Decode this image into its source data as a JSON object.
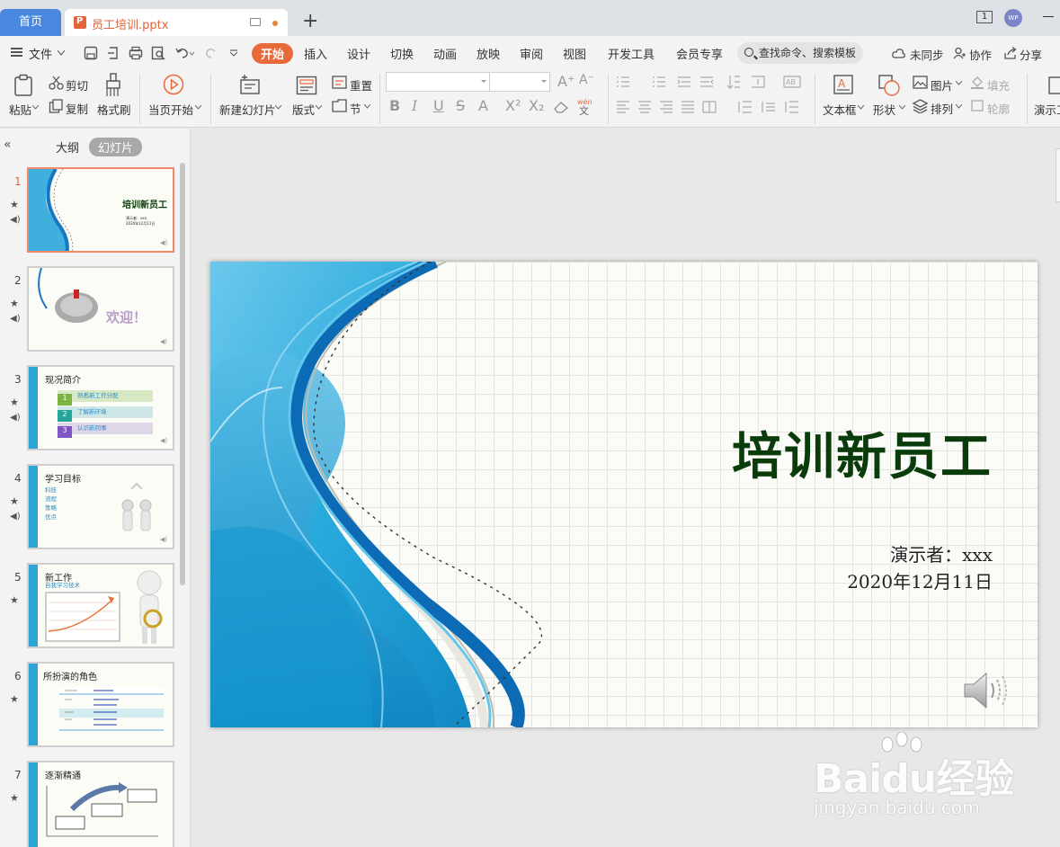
{
  "tabs": {
    "home": "首页",
    "doc": "员工培训.pptx",
    "add": "+"
  },
  "window": {
    "num": "1",
    "avatar": "WP"
  },
  "menu": {
    "file": "文件",
    "tabs": [
      "开始",
      "插入",
      "设计",
      "切换",
      "动画",
      "放映",
      "审阅",
      "视图",
      "开发工具",
      "会员专享"
    ],
    "search": "查找命令、搜索模板",
    "unsynced": "未同步",
    "collab": "协作",
    "share": "分享"
  },
  "ribbon": {
    "paste": "粘贴",
    "cut": "剪切",
    "copy": "复制",
    "format_painter": "格式刷",
    "from_current": "当页开始",
    "new_slide": "新建幻灯片",
    "layout": "版式",
    "reset": "重置",
    "section": "节",
    "textbox": "文本框",
    "shape": "形状",
    "picture": "图片",
    "arrange": "排列",
    "fill": "填充",
    "outline": "轮廓",
    "present": "演示工"
  },
  "panel": {
    "outline_tab": "大纲",
    "slides_tab": "幻灯片",
    "thumbs": [
      {
        "num": "1",
        "title": "培训新员工",
        "sub1": "演示者：xxx",
        "sub2": "2020年12月11日"
      },
      {
        "num": "2",
        "title": "欢迎！"
      },
      {
        "num": "3",
        "title": "现况简介",
        "items": [
          "熟悉新工作分配",
          "了解新环境",
          "认识新同事"
        ]
      },
      {
        "num": "4",
        "title": "学习目标",
        "items": [
          "科技",
          "流程",
          "策略",
          "优点"
        ]
      },
      {
        "num": "5",
        "title": "新工作",
        "sub": "自我学习技术"
      },
      {
        "num": "6",
        "title": "所扮演的角色"
      },
      {
        "num": "7",
        "title": "逐渐精通"
      }
    ]
  },
  "slide": {
    "title": "培训新员工",
    "presenter": "演示者：xxx",
    "date": "2020年12月11日"
  },
  "watermark": {
    "brand": "Baidu经验",
    "url": "jingyan.baidu.com"
  },
  "colors": {
    "accent": "#e86a3a",
    "home_tab": "#4a88e0",
    "title_green": "#0a3b0a",
    "wave_blue": "#1a9fd4"
  }
}
